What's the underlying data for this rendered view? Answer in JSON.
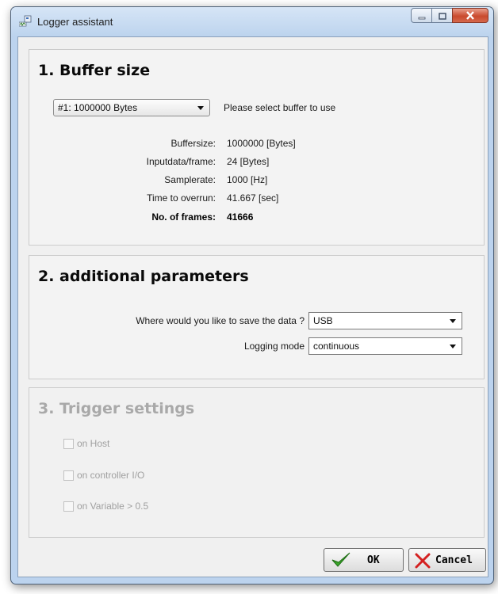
{
  "window": {
    "title": "Logger assistant"
  },
  "buffer_section": {
    "heading": "1.  Buffer size",
    "selected_buffer": "#1: 1000000 Bytes",
    "hint": "Please select buffer to use",
    "rows": [
      {
        "label": "Buffersize:",
        "value": "1000000 [Bytes]"
      },
      {
        "label": "Inputdata/frame:",
        "value": "24 [Bytes]"
      },
      {
        "label": "Samplerate:",
        "value": "1000 [Hz]"
      },
      {
        "label": "Time to overrun:",
        "value": "41.667 [sec]"
      }
    ],
    "frames_label": "No. of frames:",
    "frames_value": "41666"
  },
  "params_section": {
    "heading": "2.  additional parameters",
    "save_label": "Where would you like to save the data ?",
    "save_value": "USB",
    "mode_label": "Logging mode",
    "mode_value": "continuous"
  },
  "trigger_section": {
    "heading": "3.  Trigger settings",
    "enabled": false,
    "options": [
      {
        "label": "on Host",
        "checked": false
      },
      {
        "label": "on controller I/O",
        "checked": false
      },
      {
        "label": "on Variable > 0.5",
        "checked": false
      }
    ]
  },
  "buttons": {
    "ok": "OK",
    "cancel": "Cancel"
  },
  "icons": {
    "app": "logger-app-icon",
    "minimize": "minimize-icon",
    "maximize": "maximize-icon",
    "close": "close-icon",
    "ok": "checkmark-icon",
    "cancel": "red-x-icon"
  },
  "colors": {
    "close_button": "#c94a2e",
    "ok_icon": "#3aa52a",
    "cancel_icon": "#d42020",
    "disabled_text": "#a9a9a9"
  }
}
